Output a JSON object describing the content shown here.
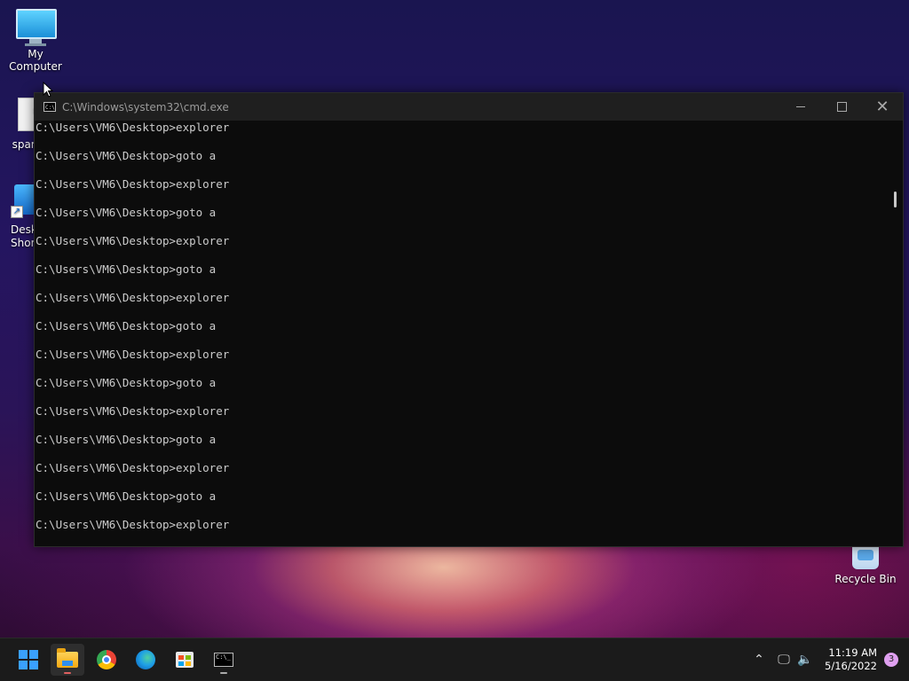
{
  "desktop": {
    "icons": [
      {
        "label": "My Computer"
      },
      {
        "label": "span"
      },
      {
        "label": "Desk Shor"
      },
      {
        "label": "Recycle Bin"
      }
    ]
  },
  "window": {
    "title": "C:\\Windows\\system32\\cmd.exe",
    "icon_text": "C:\\",
    "lines": [
      "C:\\Users\\VM6\\Desktop>explorer",
      "C:\\Users\\VM6\\Desktop>goto a",
      "C:\\Users\\VM6\\Desktop>explorer",
      "C:\\Users\\VM6\\Desktop>goto a",
      "C:\\Users\\VM6\\Desktop>explorer",
      "C:\\Users\\VM6\\Desktop>goto a",
      "C:\\Users\\VM6\\Desktop>explorer",
      "C:\\Users\\VM6\\Desktop>goto a",
      "C:\\Users\\VM6\\Desktop>explorer",
      "C:\\Users\\VM6\\Desktop>goto a",
      "C:\\Users\\VM6\\Desktop>explorer",
      "C:\\Users\\VM6\\Desktop>goto a",
      "C:\\Users\\VM6\\Desktop>explorer",
      "C:\\Users\\VM6\\Desktop>goto a",
      "C:\\Users\\VM6\\Desktop>explorer"
    ]
  },
  "taskbar": {
    "apps": [
      {
        "name": "start-button",
        "icon": "windows-logo-icon"
      },
      {
        "name": "file-explorer",
        "icon": "folder-icon"
      },
      {
        "name": "chrome",
        "icon": "chrome-icon"
      },
      {
        "name": "edge",
        "icon": "edge-icon"
      },
      {
        "name": "store",
        "icon": "store-icon"
      },
      {
        "name": "cmd",
        "icon": "terminal-icon"
      }
    ],
    "tray": {
      "time": "11:19 AM",
      "date": "5/16/2022",
      "notification_count": "3"
    }
  }
}
